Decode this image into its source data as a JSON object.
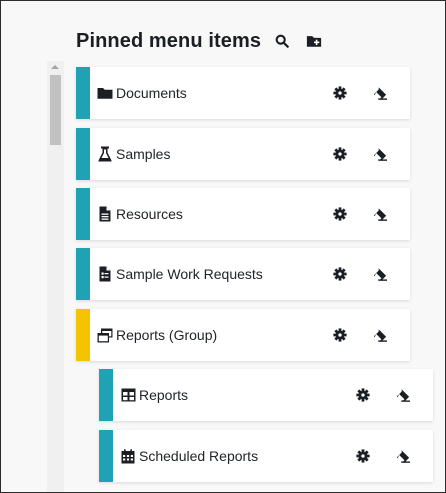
{
  "panel": {
    "title": "Pinned menu items"
  },
  "header_icons": [
    "search-icon",
    "folder-plus-icon"
  ],
  "colors": {
    "teal": "#1fa3b4",
    "yellow": "#f5c400",
    "icon": "#1b1f24"
  },
  "items": [
    {
      "label": "Documents",
      "icon": "folder-icon",
      "accent": "teal",
      "level": 0
    },
    {
      "label": "Samples",
      "icon": "flask-icon",
      "accent": "teal",
      "level": 0
    },
    {
      "label": "Resources",
      "icon": "file-icon",
      "accent": "teal",
      "level": 0
    },
    {
      "label": "Sample Work Requests",
      "icon": "file-request-icon",
      "accent": "teal",
      "level": 0
    },
    {
      "label": "Reports (Group)",
      "icon": "windows-icon",
      "accent": "yellow",
      "level": 0
    },
    {
      "label": "Reports",
      "icon": "table-icon",
      "accent": "teal",
      "level": 1
    },
    {
      "label": "Scheduled Reports",
      "icon": "calendar-icon",
      "accent": "teal",
      "level": 1
    }
  ]
}
